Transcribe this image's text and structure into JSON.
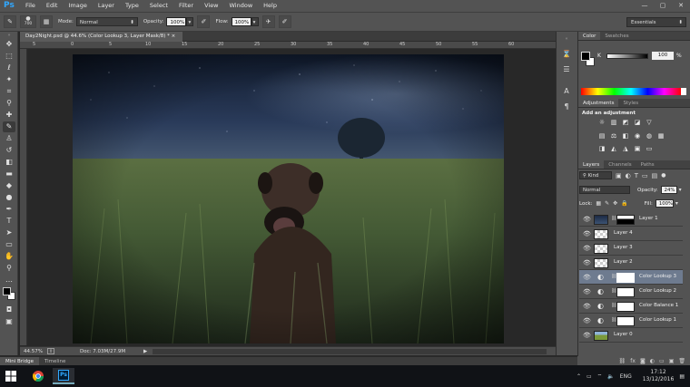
{
  "app": {
    "logo": "Ps"
  },
  "menu": [
    "File",
    "Edit",
    "Image",
    "Layer",
    "Type",
    "Select",
    "Filter",
    "View",
    "Window",
    "Help"
  ],
  "window_controls": {
    "minimize": "—",
    "maximize": "▢",
    "close": "✕"
  },
  "options": {
    "brush_size": "700",
    "mode_label": "Mode:",
    "mode_value": "Normal",
    "opacity_label": "Opacity:",
    "opacity_value": "100%",
    "flow_label": "Flow:",
    "flow_value": "100%",
    "workspace": "Essentials"
  },
  "document": {
    "tab_title": "Day2Night.psd @ 44.6% (Color Lookup 3, Layer Mask/8) *",
    "close_glyph": "×",
    "zoom": "44.57%",
    "doc_size": "Doc: 7.03M/27.9M"
  },
  "ruler": {
    "ticks": [
      "5",
      "0",
      "5",
      "10",
      "15",
      "20",
      "25",
      "30",
      "35",
      "40",
      "45",
      "50",
      "55",
      "60"
    ]
  },
  "bottom_tabs": [
    "Mini Bridge",
    "Timeline"
  ],
  "color_panel": {
    "tabs": [
      "Color",
      "Swatches"
    ],
    "k_label": "K",
    "k_value": "100",
    "k_unit": "%"
  },
  "adjustments_panel": {
    "tabs": [
      "Adjustments",
      "Styles"
    ],
    "title": "Add an adjustment"
  },
  "layers_panel": {
    "tabs": [
      "Layers",
      "Channels",
      "Paths"
    ],
    "kind_filter": "Kind",
    "blend_mode": "Normal",
    "opacity_label": "Opacity:",
    "opacity_value": "24%",
    "lock_label": "Lock:",
    "fill_label": "Fill:",
    "fill_value": "100%",
    "layers": [
      {
        "name": "Layer 1",
        "thumb": "night",
        "mask": true,
        "selected": false
      },
      {
        "name": "Layer 4",
        "thumb": "checker-cloud",
        "mask": false,
        "selected": false
      },
      {
        "name": "Layer 3",
        "thumb": "checker",
        "mask": false,
        "selected": false
      },
      {
        "name": "Layer 2",
        "thumb": "checker",
        "mask": false,
        "selected": false
      },
      {
        "name": "Color Lookup 3",
        "thumb": "adj",
        "mask": true,
        "selected": true
      },
      {
        "name": "Color Lookup 2",
        "thumb": "adj",
        "mask": true,
        "selected": false
      },
      {
        "name": "Color Balance 1",
        "thumb": "adj",
        "mask": true,
        "selected": false
      },
      {
        "name": "Color Lookup 1",
        "thumb": "adj",
        "mask": true,
        "selected": false
      },
      {
        "name": "Layer 0",
        "thumb": "photo",
        "mask": false,
        "selected": false
      }
    ]
  },
  "taskbar": {
    "language": "ENG",
    "time": "17:12",
    "date": "13/12/2016"
  },
  "colors": {
    "ui_bg": "#535353",
    "dark_bg": "#282828",
    "selection": "#6e7b8f",
    "ps_blue": "#31a8ff"
  }
}
